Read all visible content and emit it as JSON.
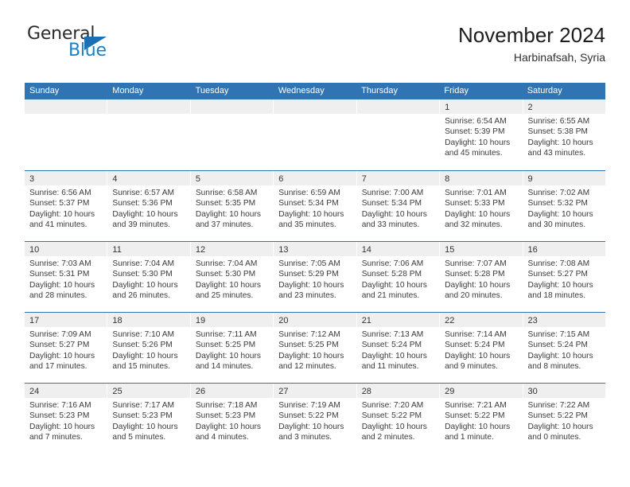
{
  "brand": {
    "name_part1": "General",
    "name_part2": "Blue",
    "triangle_icon": "blue-triangle-icon",
    "color_dark": "#2b2b2b",
    "color_blue": "#1b7fc4"
  },
  "header": {
    "title": "November 2024",
    "subtitle": "Harbinafsah, Syria"
  },
  "theme": {
    "header_bg": "#3174b4",
    "header_text": "#ffffff",
    "day_band_bg": "#efefef",
    "row_separator": "#3174b4"
  },
  "calendar": {
    "day_headers": [
      "Sunday",
      "Monday",
      "Tuesday",
      "Wednesday",
      "Thursday",
      "Friday",
      "Saturday"
    ],
    "weeks": [
      {
        "days": [
          {
            "num": "",
            "sunrise": "",
            "sunset": "",
            "daylight_line1": "",
            "daylight_line2": "",
            "empty": true
          },
          {
            "num": "",
            "sunrise": "",
            "sunset": "",
            "daylight_line1": "",
            "daylight_line2": "",
            "empty": true
          },
          {
            "num": "",
            "sunrise": "",
            "sunset": "",
            "daylight_line1": "",
            "daylight_line2": "",
            "empty": true
          },
          {
            "num": "",
            "sunrise": "",
            "sunset": "",
            "daylight_line1": "",
            "daylight_line2": "",
            "empty": true
          },
          {
            "num": "",
            "sunrise": "",
            "sunset": "",
            "daylight_line1": "",
            "daylight_line2": "",
            "empty": true
          },
          {
            "num": "1",
            "sunrise": "Sunrise: 6:54 AM",
            "sunset": "Sunset: 5:39 PM",
            "daylight_line1": "Daylight: 10 hours",
            "daylight_line2": "and 45 minutes.",
            "empty": false
          },
          {
            "num": "2",
            "sunrise": "Sunrise: 6:55 AM",
            "sunset": "Sunset: 5:38 PM",
            "daylight_line1": "Daylight: 10 hours",
            "daylight_line2": "and 43 minutes.",
            "empty": false
          }
        ]
      },
      {
        "days": [
          {
            "num": "3",
            "sunrise": "Sunrise: 6:56 AM",
            "sunset": "Sunset: 5:37 PM",
            "daylight_line1": "Daylight: 10 hours",
            "daylight_line2": "and 41 minutes.",
            "empty": false
          },
          {
            "num": "4",
            "sunrise": "Sunrise: 6:57 AM",
            "sunset": "Sunset: 5:36 PM",
            "daylight_line1": "Daylight: 10 hours",
            "daylight_line2": "and 39 minutes.",
            "empty": false
          },
          {
            "num": "5",
            "sunrise": "Sunrise: 6:58 AM",
            "sunset": "Sunset: 5:35 PM",
            "daylight_line1": "Daylight: 10 hours",
            "daylight_line2": "and 37 minutes.",
            "empty": false
          },
          {
            "num": "6",
            "sunrise": "Sunrise: 6:59 AM",
            "sunset": "Sunset: 5:34 PM",
            "daylight_line1": "Daylight: 10 hours",
            "daylight_line2": "and 35 minutes.",
            "empty": false
          },
          {
            "num": "7",
            "sunrise": "Sunrise: 7:00 AM",
            "sunset": "Sunset: 5:34 PM",
            "daylight_line1": "Daylight: 10 hours",
            "daylight_line2": "and 33 minutes.",
            "empty": false
          },
          {
            "num": "8",
            "sunrise": "Sunrise: 7:01 AM",
            "sunset": "Sunset: 5:33 PM",
            "daylight_line1": "Daylight: 10 hours",
            "daylight_line2": "and 32 minutes.",
            "empty": false
          },
          {
            "num": "9",
            "sunrise": "Sunrise: 7:02 AM",
            "sunset": "Sunset: 5:32 PM",
            "daylight_line1": "Daylight: 10 hours",
            "daylight_line2": "and 30 minutes.",
            "empty": false
          }
        ]
      },
      {
        "days": [
          {
            "num": "10",
            "sunrise": "Sunrise: 7:03 AM",
            "sunset": "Sunset: 5:31 PM",
            "daylight_line1": "Daylight: 10 hours",
            "daylight_line2": "and 28 minutes.",
            "empty": false
          },
          {
            "num": "11",
            "sunrise": "Sunrise: 7:04 AM",
            "sunset": "Sunset: 5:30 PM",
            "daylight_line1": "Daylight: 10 hours",
            "daylight_line2": "and 26 minutes.",
            "empty": false
          },
          {
            "num": "12",
            "sunrise": "Sunrise: 7:04 AM",
            "sunset": "Sunset: 5:30 PM",
            "daylight_line1": "Daylight: 10 hours",
            "daylight_line2": "and 25 minutes.",
            "empty": false
          },
          {
            "num": "13",
            "sunrise": "Sunrise: 7:05 AM",
            "sunset": "Sunset: 5:29 PM",
            "daylight_line1": "Daylight: 10 hours",
            "daylight_line2": "and 23 minutes.",
            "empty": false
          },
          {
            "num": "14",
            "sunrise": "Sunrise: 7:06 AM",
            "sunset": "Sunset: 5:28 PM",
            "daylight_line1": "Daylight: 10 hours",
            "daylight_line2": "and 21 minutes.",
            "empty": false
          },
          {
            "num": "15",
            "sunrise": "Sunrise: 7:07 AM",
            "sunset": "Sunset: 5:28 PM",
            "daylight_line1": "Daylight: 10 hours",
            "daylight_line2": "and 20 minutes.",
            "empty": false
          },
          {
            "num": "16",
            "sunrise": "Sunrise: 7:08 AM",
            "sunset": "Sunset: 5:27 PM",
            "daylight_line1": "Daylight: 10 hours",
            "daylight_line2": "and 18 minutes.",
            "empty": false
          }
        ]
      },
      {
        "days": [
          {
            "num": "17",
            "sunrise": "Sunrise: 7:09 AM",
            "sunset": "Sunset: 5:27 PM",
            "daylight_line1": "Daylight: 10 hours",
            "daylight_line2": "and 17 minutes.",
            "empty": false
          },
          {
            "num": "18",
            "sunrise": "Sunrise: 7:10 AM",
            "sunset": "Sunset: 5:26 PM",
            "daylight_line1": "Daylight: 10 hours",
            "daylight_line2": "and 15 minutes.",
            "empty": false
          },
          {
            "num": "19",
            "sunrise": "Sunrise: 7:11 AM",
            "sunset": "Sunset: 5:25 PM",
            "daylight_line1": "Daylight: 10 hours",
            "daylight_line2": "and 14 minutes.",
            "empty": false
          },
          {
            "num": "20",
            "sunrise": "Sunrise: 7:12 AM",
            "sunset": "Sunset: 5:25 PM",
            "daylight_line1": "Daylight: 10 hours",
            "daylight_line2": "and 12 minutes.",
            "empty": false
          },
          {
            "num": "21",
            "sunrise": "Sunrise: 7:13 AM",
            "sunset": "Sunset: 5:24 PM",
            "daylight_line1": "Daylight: 10 hours",
            "daylight_line2": "and 11 minutes.",
            "empty": false
          },
          {
            "num": "22",
            "sunrise": "Sunrise: 7:14 AM",
            "sunset": "Sunset: 5:24 PM",
            "daylight_line1": "Daylight: 10 hours",
            "daylight_line2": "and 9 minutes.",
            "empty": false
          },
          {
            "num": "23",
            "sunrise": "Sunrise: 7:15 AM",
            "sunset": "Sunset: 5:24 PM",
            "daylight_line1": "Daylight: 10 hours",
            "daylight_line2": "and 8 minutes.",
            "empty": false
          }
        ]
      },
      {
        "days": [
          {
            "num": "24",
            "sunrise": "Sunrise: 7:16 AM",
            "sunset": "Sunset: 5:23 PM",
            "daylight_line1": "Daylight: 10 hours",
            "daylight_line2": "and 7 minutes.",
            "empty": false
          },
          {
            "num": "25",
            "sunrise": "Sunrise: 7:17 AM",
            "sunset": "Sunset: 5:23 PM",
            "daylight_line1": "Daylight: 10 hours",
            "daylight_line2": "and 5 minutes.",
            "empty": false
          },
          {
            "num": "26",
            "sunrise": "Sunrise: 7:18 AM",
            "sunset": "Sunset: 5:23 PM",
            "daylight_line1": "Daylight: 10 hours",
            "daylight_line2": "and 4 minutes.",
            "empty": false
          },
          {
            "num": "27",
            "sunrise": "Sunrise: 7:19 AM",
            "sunset": "Sunset: 5:22 PM",
            "daylight_line1": "Daylight: 10 hours",
            "daylight_line2": "and 3 minutes.",
            "empty": false
          },
          {
            "num": "28",
            "sunrise": "Sunrise: 7:20 AM",
            "sunset": "Sunset: 5:22 PM",
            "daylight_line1": "Daylight: 10 hours",
            "daylight_line2": "and 2 minutes.",
            "empty": false
          },
          {
            "num": "29",
            "sunrise": "Sunrise: 7:21 AM",
            "sunset": "Sunset: 5:22 PM",
            "daylight_line1": "Daylight: 10 hours",
            "daylight_line2": "and 1 minute.",
            "empty": false
          },
          {
            "num": "30",
            "sunrise": "Sunrise: 7:22 AM",
            "sunset": "Sunset: 5:22 PM",
            "daylight_line1": "Daylight: 10 hours",
            "daylight_line2": "and 0 minutes.",
            "empty": false
          }
        ]
      }
    ]
  }
}
